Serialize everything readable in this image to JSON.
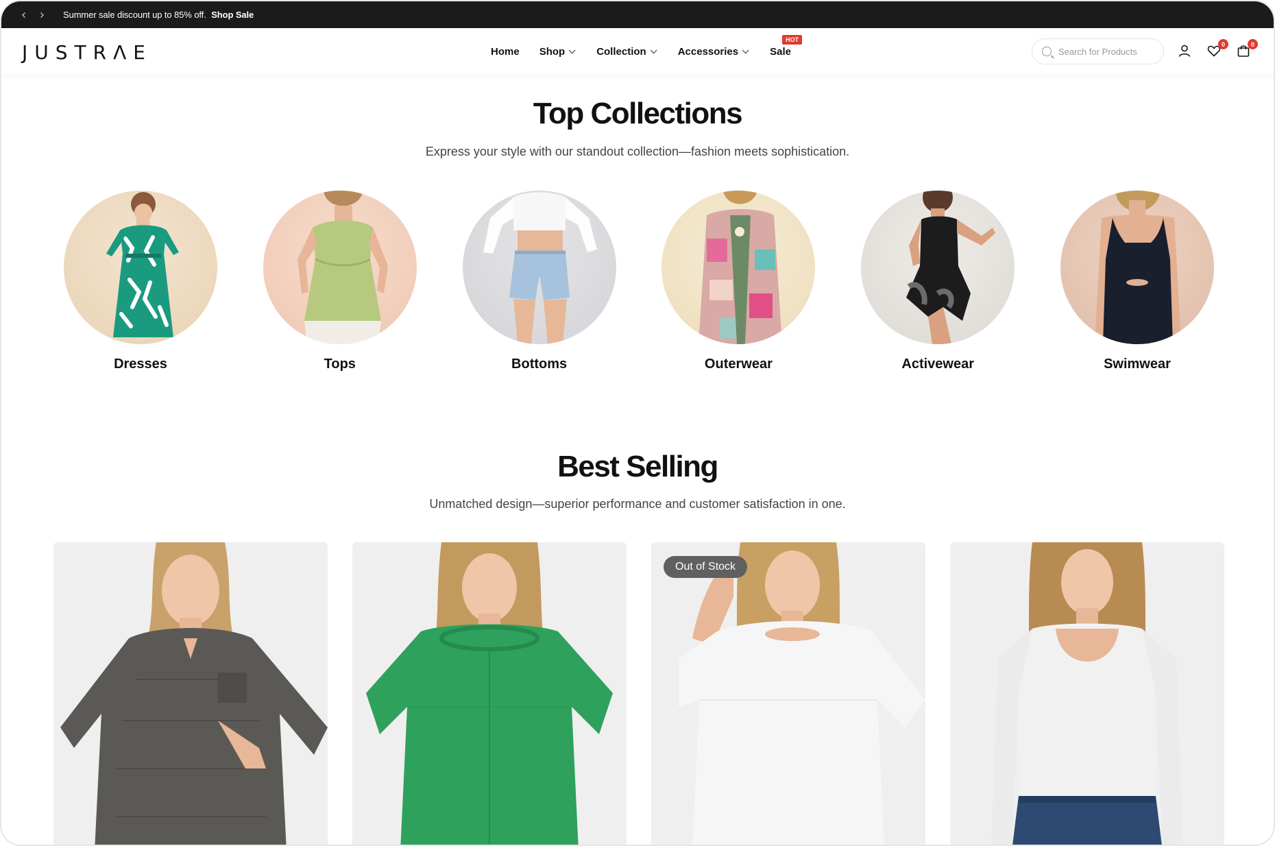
{
  "announcement": {
    "message": "Summer sale discount up to 85% off.",
    "link": "Shop Sale"
  },
  "header": {
    "logo": "JUSTRΛE",
    "nav": [
      {
        "label": "Home",
        "has_dropdown": false
      },
      {
        "label": "Shop",
        "has_dropdown": true
      },
      {
        "label": "Collection",
        "has_dropdown": true
      },
      {
        "label": "Accessories",
        "has_dropdown": true
      },
      {
        "label": "Sale",
        "has_dropdown": false,
        "badge": "HOT"
      }
    ],
    "search_placeholder": "Search for Products",
    "wishlist_count": "0",
    "cart_count": "0"
  },
  "top_collections": {
    "title": "Top Collections",
    "subtitle": "Express your style with our standout collection—fashion meets sophistication.",
    "items": [
      {
        "label": "Dresses"
      },
      {
        "label": "Tops"
      },
      {
        "label": "Bottoms"
      },
      {
        "label": "Outerwear"
      },
      {
        "label": "Activewear"
      },
      {
        "label": "Swimwear"
      }
    ]
  },
  "best_selling": {
    "title": "Best Selling",
    "subtitle": "Unmatched design—superior performance and customer satisfaction in one.",
    "products": [
      {
        "badge": ""
      },
      {
        "badge": ""
      },
      {
        "badge": "Out of Stock"
      },
      {
        "badge": ""
      }
    ]
  },
  "colors": {
    "announce_bg": "#1b1b1b",
    "badge_red": "#e03a2f",
    "card_bg": "#efefef"
  }
}
